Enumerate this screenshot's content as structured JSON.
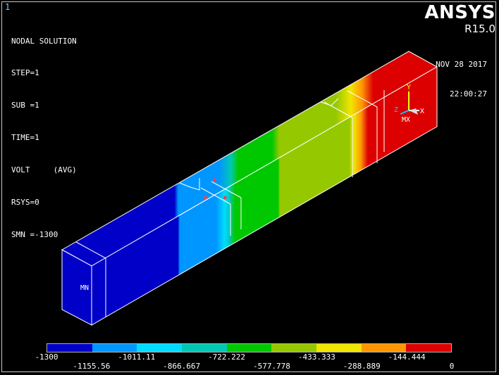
{
  "window_number": "1",
  "plot_info": {
    "title": "NODAL SOLUTION",
    "lines": [
      "STEP=1",
      "SUB =1",
      "TIME=1",
      "VOLT     (AVG)",
      "RSYS=0",
      "SMN =-1300"
    ]
  },
  "brand": {
    "name": "ANSYS",
    "version": "R15.0"
  },
  "timestamp": {
    "date": "NOV 28 2017",
    "time": "22:00:27"
  },
  "model_labels": {
    "min_marker": "MN",
    "max_marker": "MX"
  },
  "triad": {
    "x": "X",
    "y": "Y",
    "z": "Z"
  },
  "contour_colors": [
    "#0000c8",
    "#0096ff",
    "#00dcff",
    "#00c8b4",
    "#00c800",
    "#96c800",
    "#f0e600",
    "#ff9600",
    "#dc0000"
  ],
  "legend": {
    "bottom_values": [
      "-1300",
      "-1011.11",
      "-722.222",
      "-433.333",
      "-144.444"
    ],
    "top_values": [
      "-1155.56",
      "-866.667",
      "-577.778",
      "-288.889",
      "0"
    ]
  }
}
